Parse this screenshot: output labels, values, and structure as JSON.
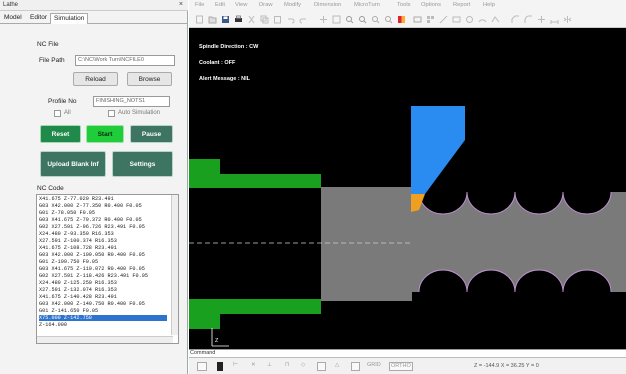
{
  "panel": {
    "title": "Lathe",
    "close_glyph": "×",
    "tabs": [
      "Model",
      "Editor",
      "Simulation"
    ],
    "nc_file_label": "NC File",
    "file_path_label": "File Path",
    "file_path_value": "C:\\NC\\Work Turn\\NCFILE0",
    "reload_label": "Reload",
    "browse_label": "Browse",
    "profile_no_label": "Profile No",
    "profile_no_value": "FINISHING_NOTS1",
    "all_label": "All",
    "auto_simulation_label": "Auto Simulation",
    "reset_label": "Reset",
    "start_label": "Start",
    "pause_label": "Pause",
    "upload_label": "Upload Blank Inf",
    "settings_label": "Settings",
    "nc_code_label": "NC Code",
    "nc_code_lines": [
      "X41.675 Z-77.020 R23.491",
      "G03 X42.000 Z-77.350 R0.400 F0.05",
      "G01 Z-78.050 F0.05",
      "G03 X41.675 Z-79.372 R0.400 F0.05",
      "G02 X27.591 Z-96.726 R23.491 F0.05",
      "X24.480 Z-93.350 R16.353",
      "X27.591 Z-100.374 R16.353",
      "X41.675 Z-108.728 R23.491",
      "G03 X42.000 Z-109.050 R0.400 F0.05",
      "G01 Z-109.750 F0.05",
      "G03 X41.675 Z-110.072 R0.400 F0.05",
      "G02 X27.591 Z-118.426 R23.491 F0.05",
      "X24.480 Z-125.250 R16.353",
      "X27.591 Z-132.074 R16.353",
      "X41.675 Z-140.428 R23.491",
      "G03 X42.000 Z-140.750 R0.400 F0.05",
      "G01 Z-141.650 F0.05",
      "X75.000 Z-142.750",
      "Z-164.000"
    ],
    "selected_line_index": 17
  },
  "menubar": [
    "File",
    "Edit",
    "View",
    "Draw",
    "Modify",
    "Dimension",
    "MicroTurn",
    "Tools",
    "Options",
    "Report",
    "Help"
  ],
  "canvas": {
    "spindle": "Spindle Direction : CW",
    "coolant": "Coolant : OFF",
    "alert": "Alert Message : NIL",
    "axis_label": "Z",
    "colors": {
      "chuck": "#19a01f",
      "stock": "#7a7a7a",
      "tool": "#2a8cf0",
      "insert": "#f0a020",
      "profile": "#c090d0"
    }
  },
  "command_label": "Command",
  "status": {
    "coords": "Z = -144.9  X = 36.25  Y = 0",
    "grid_label": "GRID",
    "ortho_label": "ORTHO",
    "icons": [
      "grid-icon",
      "select-icon",
      "snap-icon",
      "pan-icon",
      "snap-point-icon",
      "lock-icon",
      "circle-icon",
      "angle-icon",
      "rect-icon"
    ]
  }
}
